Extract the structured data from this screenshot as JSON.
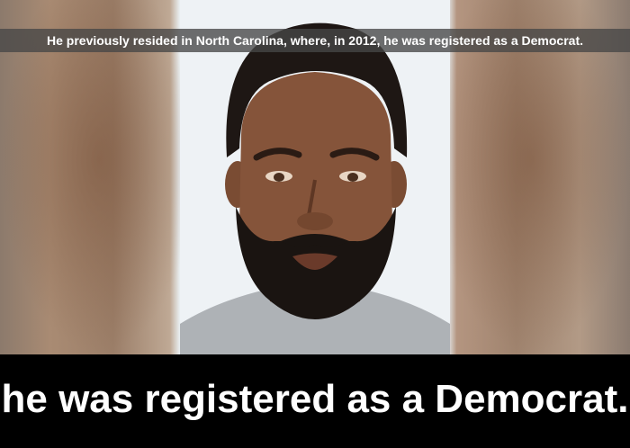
{
  "captions": {
    "top": "He previously resided in North Carolina, where, in 2012, he was registered as a Democrat.",
    "bottom": "he was registered as a Democrat."
  },
  "colors": {
    "caption_bar": "#464646",
    "bottom_bar": "#000000",
    "portrait_background": "#eef2f5",
    "caption_text": "#ffffff"
  }
}
